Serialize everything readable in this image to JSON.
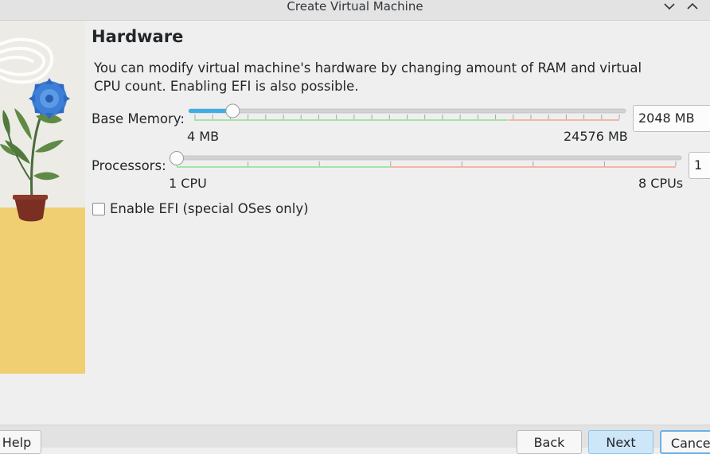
{
  "window": {
    "title": "Create Virtual Machine",
    "controls": [
      "chevron-down-icon",
      "chevron-up-icon"
    ]
  },
  "page": {
    "heading": "Hardware",
    "description": "You can modify virtual machine's hardware by changing amount of RAM and virtual CPU count. Enabling EFI is also possible."
  },
  "memory": {
    "label": "Base Memory:",
    "min_label": "4 MB",
    "max_label": "24576 MB",
    "value_text": "2048 MB",
    "value": 2048,
    "min": 4,
    "max": 24576
  },
  "processors": {
    "label": "Processors:",
    "min_label": "1 CPU",
    "max_label": "8 CPUs",
    "value_text": "1",
    "value": 1,
    "min": 1,
    "max": 8
  },
  "efi": {
    "label": "Enable EFI (special OSes only)",
    "checked": false
  },
  "buttons": {
    "help": "Help",
    "back": "Back",
    "next": "Next",
    "cancel": "Cancel"
  },
  "colors": {
    "slider_fill": "#3daee9",
    "good_range": "#a6e3a9",
    "bad_range": "#f5b4a7",
    "accent_button": "#cde6f8"
  }
}
